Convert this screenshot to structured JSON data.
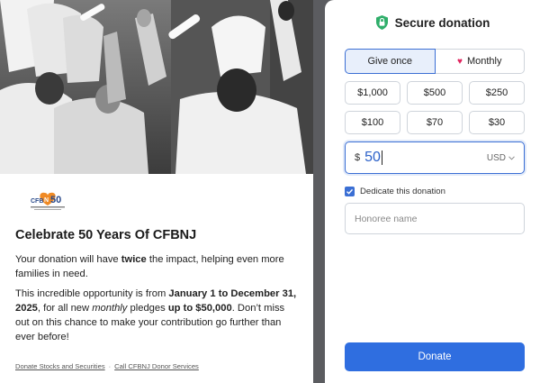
{
  "campaign": {
    "logo_text": "CFBNJ 50",
    "title": "Celebrate 50 Years Of CFBNJ",
    "para1_pre": "Your donation will have ",
    "para1_bold": "twice",
    "para1_post": " the impact, helping even more families in need.",
    "para2_pre": "This incredible opportunity is from ",
    "para2_bold1": "January 1 to December 31, 2025",
    "para2_mid1": ", for all new ",
    "para2_ital": "monthly",
    "para2_mid2": " pledges ",
    "para2_bold2": "up to $50,000",
    "para2_post": ". Don’t miss out on this chance to make your contribution go further than ever before!",
    "link1": "Donate Stocks and Securities",
    "separator": "·",
    "link2": "Call CFBNJ Donor Services"
  },
  "donation": {
    "header": "Secure donation",
    "frequency": {
      "once_label": "Give once",
      "monthly_label": "Monthly",
      "selected": "once"
    },
    "amounts": [
      "$1,000",
      "$500",
      "$250",
      "$100",
      "$70",
      "$30"
    ],
    "custom": {
      "currency_symbol": "$",
      "value": "50",
      "currency_code": "USD"
    },
    "dedicate_label": "Dedicate this donation",
    "dedicate_checked": true,
    "honoree_placeholder": "Honoree name",
    "donate_label": "Donate"
  },
  "colors": {
    "accent": "#2f6ee0",
    "selected_bg": "#e8effb",
    "shield": "#2fae6a",
    "heart": "#e0245e",
    "logo_orange": "#f08a24"
  },
  "icons": {
    "header": "shield-lock-icon",
    "monthly": "heart-icon",
    "currency_dropdown": "chevron-down-icon",
    "checkbox": "check-icon"
  }
}
